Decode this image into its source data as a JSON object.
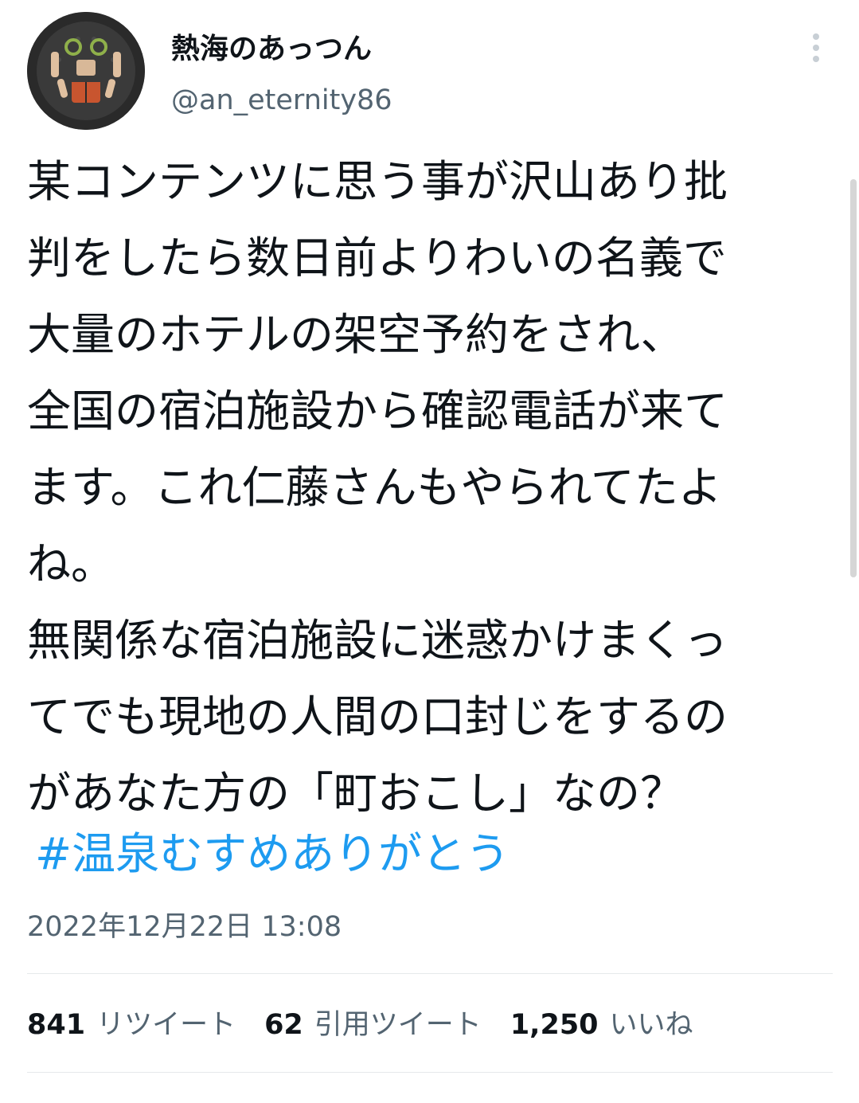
{
  "author": {
    "display_name": "熱海のあっつん",
    "handle": "@an_eternity86"
  },
  "tweet": {
    "lines": [
      "某コンテンツに思う事が沢山あり批",
      "判をしたら数日前よりわいの名義で",
      "大量のホテルの架空予約をされ、",
      "全国の宿泊施設から確認電話が来て",
      "ます。これ仁藤さんもやられてたよ",
      "ね。",
      "無関係な宿泊施設に迷惑かけまくっ",
      "てでも現地の人間の口封じをするの",
      "があなた方の「町おこし」なの？"
    ],
    "hashtag": "#温泉むすめありがとう",
    "timestamp": "2022年12月22日 13:08"
  },
  "stats": {
    "retweets": {
      "count": "841",
      "label": "リツイート"
    },
    "quotes": {
      "count": "62",
      "label": "引用ツイート"
    },
    "likes": {
      "count": "1,250",
      "label": "いいね"
    }
  },
  "colors": {
    "link": "#1d9bf0",
    "secondary_text": "#536471",
    "divider": "#e6e9eb"
  },
  "icons": {
    "more": "more-vertical-icon"
  }
}
